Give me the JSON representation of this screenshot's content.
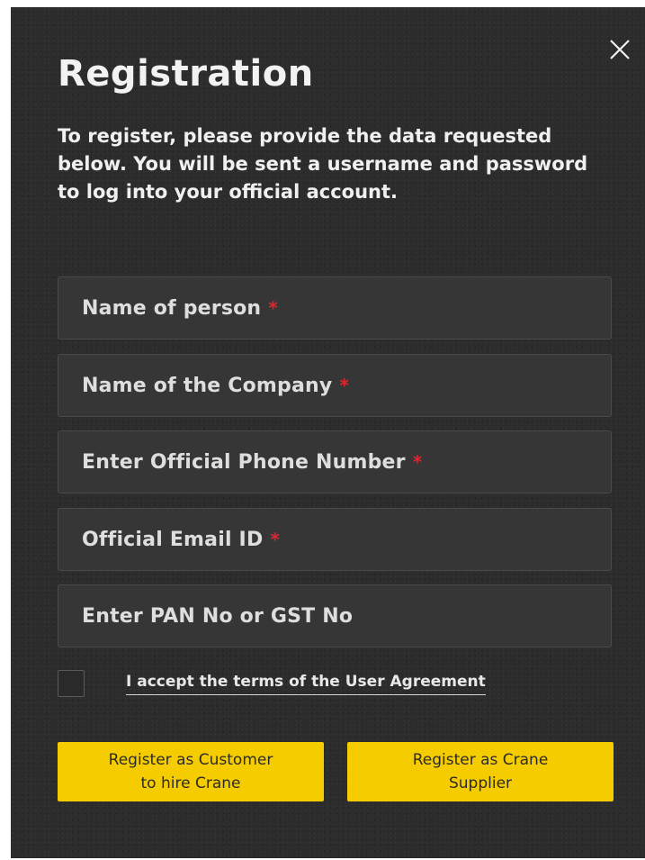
{
  "modal": {
    "title": "Registration",
    "intro": "To register, please provide the data requested below. You will be sent a username and password to log into your official account.",
    "close_icon": "close-icon"
  },
  "form": {
    "fields": [
      {
        "placeholder": "Name of person",
        "required_mark": "*"
      },
      {
        "placeholder": "Name of the Company",
        "required_mark": "*"
      },
      {
        "placeholder": "Enter Official Phone Number",
        "required_mark": "*"
      },
      {
        "placeholder": "Official Email ID",
        "required_mark": "*"
      },
      {
        "placeholder": "Enter PAN No or GST No"
      }
    ],
    "agreement_label": "I accept the terms of the User Agreement",
    "agreement_checked": false
  },
  "actions": {
    "customer_button_label": "Register as Customer\nto hire Crane",
    "supplier_button_label": "Register as Crane\nSupplier"
  },
  "colors": {
    "background": "#2c2c2c",
    "field_background": "#363636",
    "required": "#e0242c",
    "button": "#f5cc00"
  }
}
